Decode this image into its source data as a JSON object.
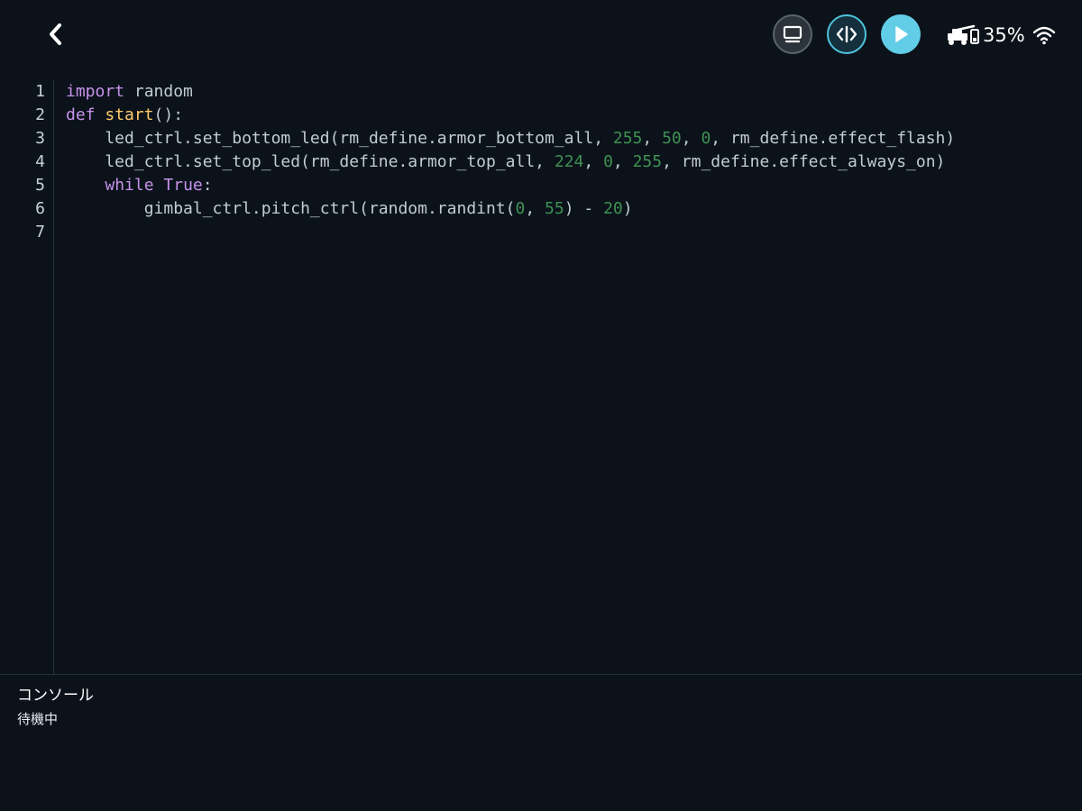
{
  "header": {
    "icons": {
      "back": "chevron-left-icon",
      "monitor": "monitor-icon",
      "code": "code-icon",
      "run": "play-icon",
      "robot": "robot-icon",
      "wifi": "wifi-icon"
    },
    "battery_text": "35%"
  },
  "editor": {
    "line_numbers": [
      "1",
      "2",
      "3",
      "4",
      "5",
      "6",
      "7"
    ],
    "lines": [
      [
        {
          "text": "import",
          "type": "kw"
        },
        {
          "text": " random",
          "type": "pl"
        }
      ],
      [
        {
          "text": "def",
          "type": "kw"
        },
        {
          "text": " ",
          "type": "pl"
        },
        {
          "text": "start",
          "type": "fn"
        },
        {
          "text": "():",
          "type": "pl"
        }
      ],
      [
        {
          "text": "    led_ctrl.set_bottom_led(rm_define.armor_bottom_all, ",
          "type": "pl"
        },
        {
          "text": "255",
          "type": "num"
        },
        {
          "text": ", ",
          "type": "pl"
        },
        {
          "text": "50",
          "type": "num"
        },
        {
          "text": ", ",
          "type": "pl"
        },
        {
          "text": "0",
          "type": "num"
        },
        {
          "text": ", rm_define.effect_flash)",
          "type": "pl"
        }
      ],
      [
        {
          "text": "    led_ctrl.set_top_led(rm_define.armor_top_all, ",
          "type": "pl"
        },
        {
          "text": "224",
          "type": "num"
        },
        {
          "text": ", ",
          "type": "pl"
        },
        {
          "text": "0",
          "type": "num"
        },
        {
          "text": ", ",
          "type": "pl"
        },
        {
          "text": "255",
          "type": "num"
        },
        {
          "text": ", rm_define.effect_always_on)",
          "type": "pl"
        }
      ],
      [
        {
          "text": "    ",
          "type": "pl"
        },
        {
          "text": "while",
          "type": "kw"
        },
        {
          "text": " ",
          "type": "pl"
        },
        {
          "text": "True",
          "type": "kw"
        },
        {
          "text": ":",
          "type": "pl"
        }
      ],
      [
        {
          "text": "        gimbal_ctrl.pitch_ctrl(random.randint(",
          "type": "pl"
        },
        {
          "text": "0",
          "type": "num"
        },
        {
          "text": ", ",
          "type": "pl"
        },
        {
          "text": "55",
          "type": "num"
        },
        {
          "text": ") - ",
          "type": "pl"
        },
        {
          "text": "20",
          "type": "num"
        },
        {
          "text": ")",
          "type": "pl"
        }
      ],
      []
    ]
  },
  "console": {
    "title": "コンソール",
    "status": "待機中"
  },
  "colors": {
    "background": "#0b121a",
    "accent": "#62cde6",
    "keyword": "#c792ea",
    "function": "#ffcb6b",
    "number": "#3f9152",
    "plain": "#c3cbd4"
  }
}
